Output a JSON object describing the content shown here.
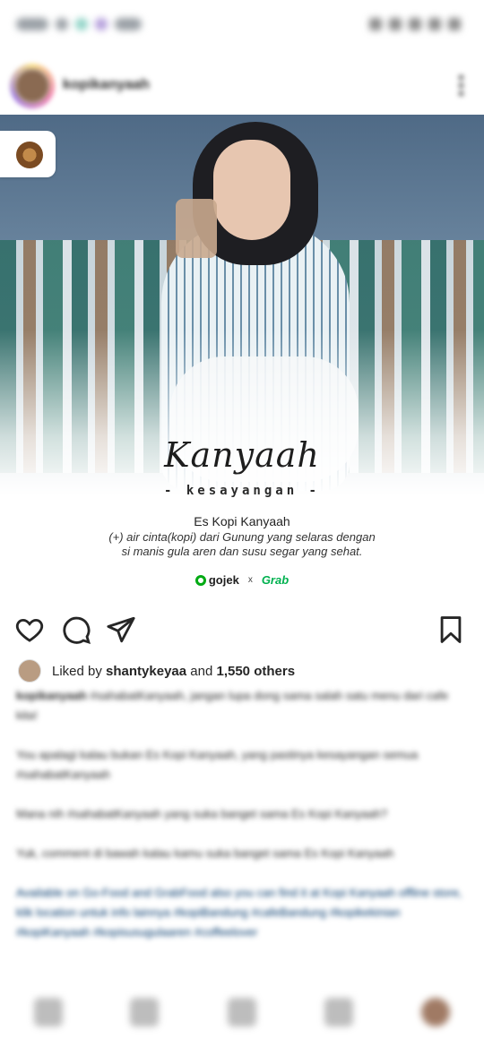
{
  "status_bar": {},
  "post": {
    "username": "kopikanyaah",
    "image": {
      "script_title": "Kanyaah",
      "subtitle": "- kesayangan -",
      "product_name": "Es Kopi Kanyaah",
      "description_lines": [
        "(+) air cinta(kopi) dari Gunung yang selaras dengan",
        "si manis gula aren dan susu segar yang sehat."
      ],
      "partners": {
        "gojek": "gojek",
        "separator": "x",
        "grab": "Grab"
      }
    }
  },
  "actions": {
    "like": "heart-icon",
    "comment": "comment-icon",
    "share": "share-icon",
    "save": "bookmark-icon"
  },
  "likes": {
    "prefix": "Liked by ",
    "user": "shantykeyaa",
    "middle": " and ",
    "count": "1,550 others"
  },
  "caption": {
    "user": "kopikanyaah",
    "paragraphs": [
      "#sahabatKanyaah, jangan lupa dong sama salah satu menu dari cafe kita!",
      "You apalagi kalau bukan Es Kopi Kanyaah, yang pastinya kesayangan semua #sahabatKanyaah",
      "Mana nih #sahabatKanyaah yang suka banget sama Es Kopi Kanyaah?",
      "Yuk, comment di bawah kalau kamu suka banget sama Es Kopi Kanyaah",
      "Available on Go-Food and GrabFood also you can find it at Kopi Kanyaah offline store, klik location untuk info lainnya #kopiBandung #cafeBandung #kopikekinian #kopiKanyaah #kopisusugulaaren #coffeelover"
    ]
  },
  "bottom_nav": [
    "home-icon",
    "search-icon",
    "reels-icon",
    "activity-icon",
    "profile-avatar"
  ],
  "colors": {
    "gojek_green": "#00aa13",
    "grab_green": "#00b14f",
    "link_blue": "#00376b"
  }
}
